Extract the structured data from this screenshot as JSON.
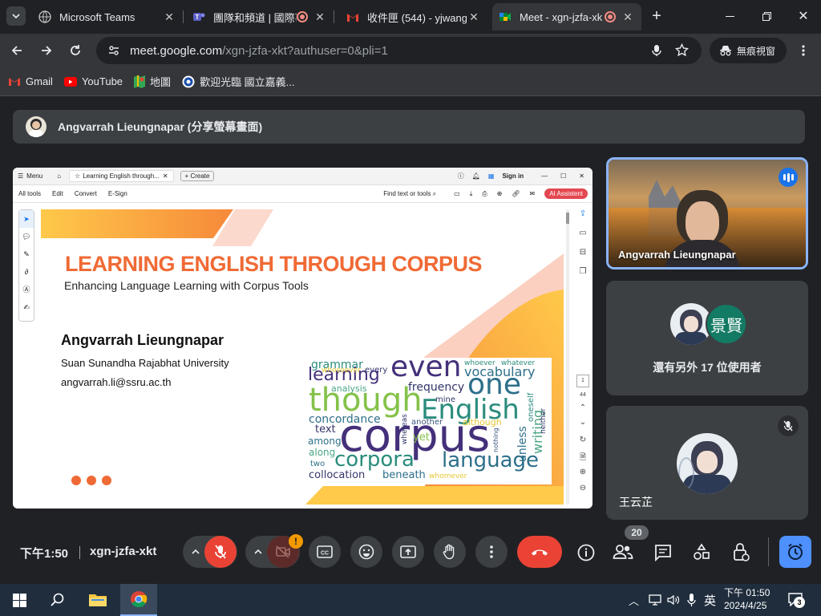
{
  "tabs": [
    {
      "title": "Microsoft Teams",
      "icon": "globe-icon"
    },
    {
      "title": "團隊和頻道 | 國際事",
      "icon": "teams-icon"
    },
    {
      "title": "收件匣 (544) - yjwang",
      "icon": "gmail-icon"
    },
    {
      "title": "Meet - xgn-jzfa-xk",
      "icon": "meet-icon"
    }
  ],
  "address": {
    "host": "meet.google.com",
    "path": "/xgn-jzfa-xkt?authuser=0&pli=1"
  },
  "incognito_label": "無痕視窗",
  "bookmarks": [
    {
      "label": "Gmail",
      "icon": "gmail-icon"
    },
    {
      "label": "YouTube",
      "icon": "youtube-icon"
    },
    {
      "label": "地圖",
      "icon": "maps-icon"
    },
    {
      "label": "歡迎光臨 國立嘉義...",
      "icon": "school-icon"
    }
  ],
  "presenter_banner": "Angvarrah Lieungnapar (分享螢幕畫面)",
  "pdf": {
    "menu": "Menu",
    "tab_title": "Learning English through...",
    "create": "Create",
    "sign_in": "Sign in",
    "tools": [
      "All tools",
      "Edit",
      "Convert",
      "E-Sign"
    ],
    "find": "Find text or tools",
    "ai": "AI Assistent",
    "page_num": "1",
    "page_total": "44"
  },
  "slide": {
    "title": "LEARNING ENGLISH THROUGH CORPUS",
    "subtitle": "Enhancing Language Learning with Corpus Tools",
    "author": "Angvarrah Lieungnapar",
    "university": "Suan Sunandha Rajabhat University",
    "email": "angvarrah.li@ssru.ac.th"
  },
  "wordcloud": [
    {
      "w": "grammar"
    },
    {
      "w": "every"
    },
    {
      "w": "even"
    },
    {
      "w": "whoever"
    },
    {
      "w": "whatever"
    },
    {
      "w": "learning"
    },
    {
      "w": "vocabulary"
    },
    {
      "w": "analysis"
    },
    {
      "w": "frequency"
    },
    {
      "w": "one"
    },
    {
      "w": "though"
    },
    {
      "w": "mine"
    },
    {
      "w": "English"
    },
    {
      "w": "concordance"
    },
    {
      "w": "another"
    },
    {
      "w": "although"
    },
    {
      "w": "text"
    },
    {
      "w": "corpus"
    },
    {
      "w": "among"
    },
    {
      "w": "yet"
    },
    {
      "w": "along"
    },
    {
      "w": "unless"
    },
    {
      "w": "writing"
    },
    {
      "w": "oneself"
    },
    {
      "w": "neither"
    },
    {
      "w": "two"
    },
    {
      "w": "corpora"
    },
    {
      "w": "language"
    },
    {
      "w": "collocation"
    },
    {
      "w": "beneath"
    },
    {
      "w": "whomever"
    },
    {
      "w": "whereas"
    },
    {
      "w": "nothing"
    },
    {
      "w": "whosoever"
    }
  ],
  "tiles": {
    "speaker_name": "Angvarrah Lieungnapar",
    "others_avatar_initials": "景賢",
    "others_label": "還有另外 17 位使用者",
    "user_name": "王云芷"
  },
  "bottom": {
    "time": "下午1:50",
    "meeting_code": "xgn-jzfa-xkt",
    "participants_count": "20"
  },
  "taskbar": {
    "ime": "英",
    "time": "下午 01:50",
    "date": "2024/4/25",
    "notifications": "3"
  },
  "colors": {
    "accent_orange": "#f06a35",
    "meet_red": "#ea4335",
    "active_blue": "#8ab4f8"
  }
}
